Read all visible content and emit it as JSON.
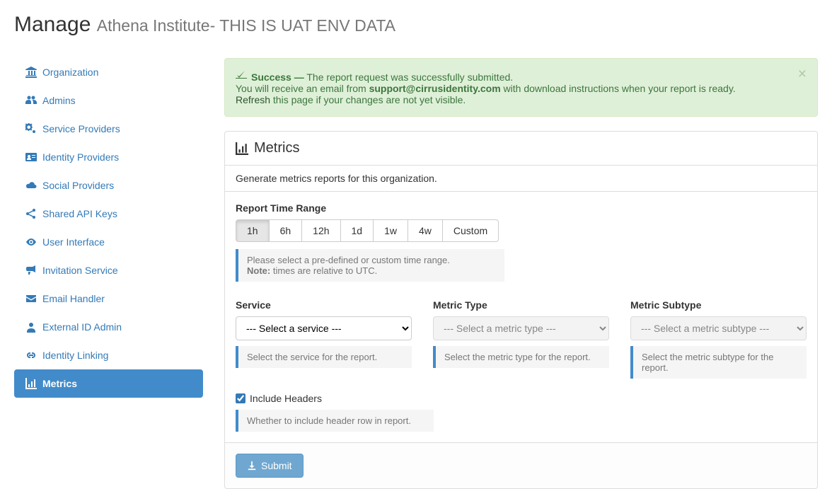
{
  "header": {
    "title": "Manage",
    "subtitle": "Athena Institute- THIS IS UAT ENV DATA"
  },
  "sidebar": {
    "items": [
      {
        "label": "Organization"
      },
      {
        "label": "Admins"
      },
      {
        "label": "Service Providers"
      },
      {
        "label": "Identity Providers"
      },
      {
        "label": "Social Providers"
      },
      {
        "label": "Shared API Keys"
      },
      {
        "label": "User Interface"
      },
      {
        "label": "Invitation Service"
      },
      {
        "label": "Email Handler"
      },
      {
        "label": "External ID Admin"
      },
      {
        "label": "Identity Linking"
      },
      {
        "label": "Metrics"
      }
    ]
  },
  "alert": {
    "success_label": "Success —",
    "message": "The report request was successfully submitted.",
    "line2_prefix": "You will receive an email from ",
    "email": "support@cirrusidentity.com",
    "line2_suffix": " with download instructions when your report is ready.",
    "refresh_link": "Refresh",
    "line3_suffix": " this page if your changes are not yet visible."
  },
  "panel": {
    "title": "Metrics",
    "description": "Generate metrics reports for this organization."
  },
  "time_range": {
    "label": "Report Time Range",
    "options": [
      "1h",
      "6h",
      "12h",
      "1d",
      "1w",
      "4w",
      "Custom"
    ],
    "selected": "1h",
    "help_line1": "Please select a pre-defined or custom time range.",
    "help_note_label": "Note:",
    "help_note_text": " times are relative to UTC."
  },
  "service": {
    "label": "Service",
    "selected": "--- Select a service ---",
    "help": "Select the service for the report."
  },
  "metric_type": {
    "label": "Metric Type",
    "selected": "--- Select a metric type ---",
    "help": "Select the metric type for the report."
  },
  "metric_subtype": {
    "label": "Metric Subtype",
    "selected": "--- Select a metric subtype ---",
    "help": "Select the metric subtype for the report."
  },
  "include_headers": {
    "label": "Include Headers",
    "checked": true,
    "help": "Whether to include header row in report."
  },
  "submit": {
    "label": "Submit"
  }
}
